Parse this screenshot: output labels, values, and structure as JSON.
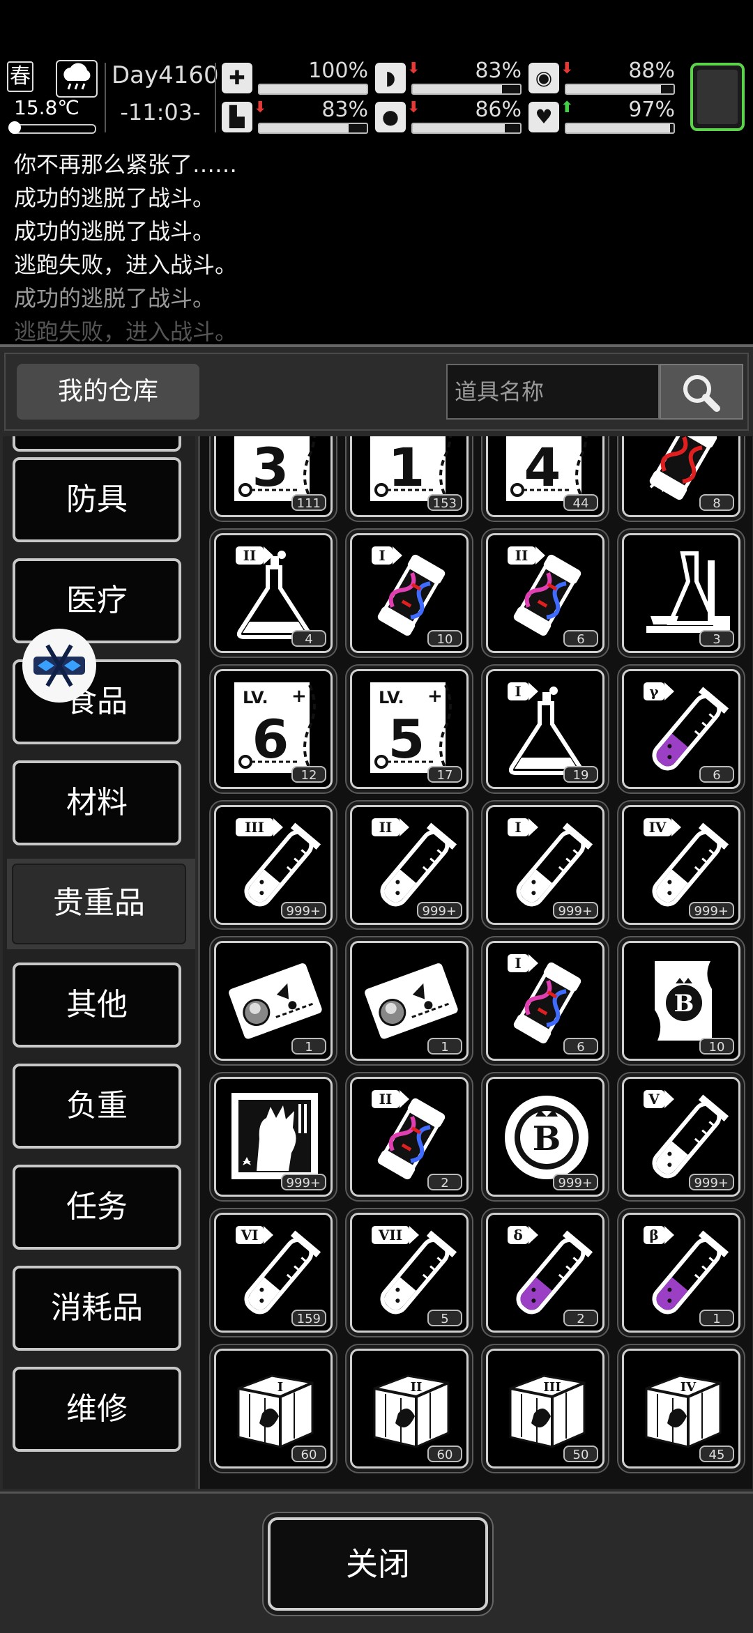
{
  "status_bar": {
    "season": "春",
    "weather_icon": "rain-cloud-icon",
    "temperature": "15.8℃",
    "day": "Day4160",
    "time": "-11:03-"
  },
  "stats": [
    {
      "name": "health",
      "icon": "medkit-icon",
      "value": "100%",
      "level": 1.0,
      "trend": "none"
    },
    {
      "name": "hunger",
      "icon": "stomach-icon",
      "value": "83%",
      "level": 0.83,
      "trend": "down"
    },
    {
      "name": "stamina",
      "icon": "face-mask-icon",
      "value": "88%",
      "level": 0.88,
      "trend": "down"
    },
    {
      "name": "leg",
      "icon": "boot-icon",
      "value": "83%",
      "level": 0.83,
      "trend": "down"
    },
    {
      "name": "thirst",
      "icon": "water-drop-icon",
      "value": "86%",
      "level": 0.86,
      "trend": "down"
    },
    {
      "name": "mood",
      "icon": "heart-icon",
      "value": "97%",
      "level": 0.97,
      "trend": "up"
    }
  ],
  "colors": {
    "down_arrow": "#e53935",
    "up_arrow": "#43d047",
    "avatar_border": "#5bd34a",
    "purple_liquid": "#9b3fc4",
    "dna_red": "#e02020",
    "dna_blue": "#3f6cff",
    "dna_pink": "#e03fb2"
  },
  "log": [
    "你不再那么紧张了……",
    "成功的逃脱了战斗。",
    "成功的逃脱了战斗。",
    "逃跑失败，进入战斗。",
    "成功的逃脱了战斗。",
    "逃跑失败，进入战斗。"
  ],
  "panel": {
    "title": "我的仓库",
    "search_placeholder": "道具名称"
  },
  "categories": [
    {
      "label": "防具",
      "active": false
    },
    {
      "label": "医疗",
      "active": false
    },
    {
      "label": "食品",
      "active": false
    },
    {
      "label": "材料",
      "active": false
    },
    {
      "label": "贵重品",
      "active": true
    },
    {
      "label": "其他",
      "active": false
    },
    {
      "label": "负重",
      "active": false
    },
    {
      "label": "任务",
      "active": false
    },
    {
      "label": "消耗品",
      "active": false
    },
    {
      "label": "维修",
      "active": false
    }
  ],
  "items": [
    {
      "icon": "skill-book-icon",
      "label": "LV.",
      "num": "3",
      "count": "111"
    },
    {
      "icon": "skill-book-icon",
      "label": "LV.",
      "num": "1",
      "count": "153"
    },
    {
      "icon": "skill-book-icon",
      "label": "LV.",
      "num": "4",
      "count": "44"
    },
    {
      "icon": "dna-capsule-broken-icon",
      "count": "8"
    },
    {
      "icon": "flask-icon",
      "tier": "II",
      "count": "4"
    },
    {
      "icon": "dna-capsule-icon",
      "tier": "I",
      "count": "10"
    },
    {
      "icon": "dna-capsule-icon",
      "tier": "II",
      "count": "6"
    },
    {
      "icon": "lab-equipment-icon",
      "count": "3"
    },
    {
      "icon": "skill-book-icon",
      "label": "LV.",
      "num": "6",
      "count": "12"
    },
    {
      "icon": "skill-book-icon",
      "label": "LV.",
      "num": "5",
      "count": "17"
    },
    {
      "icon": "flask-icon",
      "tier": "I",
      "count": "19"
    },
    {
      "icon": "test-tube-icon",
      "tier": "γ",
      "purple": true,
      "count": "6"
    },
    {
      "icon": "test-tube-icon",
      "tier": "III",
      "count": "999+"
    },
    {
      "icon": "test-tube-icon",
      "tier": "II",
      "count": "999+"
    },
    {
      "icon": "test-tube-icon",
      "tier": "I",
      "count": "999+"
    },
    {
      "icon": "test-tube-icon",
      "tier": "IV",
      "count": "999+"
    },
    {
      "icon": "ticket-icon",
      "count": "1"
    },
    {
      "icon": "ticket-icon",
      "count": "1"
    },
    {
      "icon": "dna-capsule-icon",
      "tier": "I",
      "count": "6"
    },
    {
      "icon": "b-scroll-icon",
      "count": "10"
    },
    {
      "icon": "zombie-card-icon",
      "count": "999+"
    },
    {
      "icon": "dna-capsule-icon",
      "tier": "II",
      "count": "2"
    },
    {
      "icon": "b-coin-icon",
      "count": "999+"
    },
    {
      "icon": "test-tube-icon",
      "tier": "V",
      "count": "999+"
    },
    {
      "icon": "test-tube-icon",
      "tier": "VI",
      "count": "159"
    },
    {
      "icon": "test-tube-icon",
      "tier": "VII",
      "count": "5"
    },
    {
      "icon": "test-tube-icon",
      "tier": "δ",
      "purple": true,
      "count": "2"
    },
    {
      "icon": "test-tube-icon",
      "tier": "β",
      "purple": true,
      "count": "1"
    },
    {
      "icon": "supply-crate-icon",
      "tier": "I",
      "count": "60"
    },
    {
      "icon": "supply-crate-icon",
      "tier": "II",
      "count": "60"
    },
    {
      "icon": "supply-crate-icon",
      "tier": "III",
      "count": "50"
    },
    {
      "icon": "supply-crate-icon",
      "tier": "IV",
      "count": "45"
    }
  ],
  "footer": {
    "close_label": "关闭"
  },
  "float_button_icon": "floating-assistant-icon"
}
